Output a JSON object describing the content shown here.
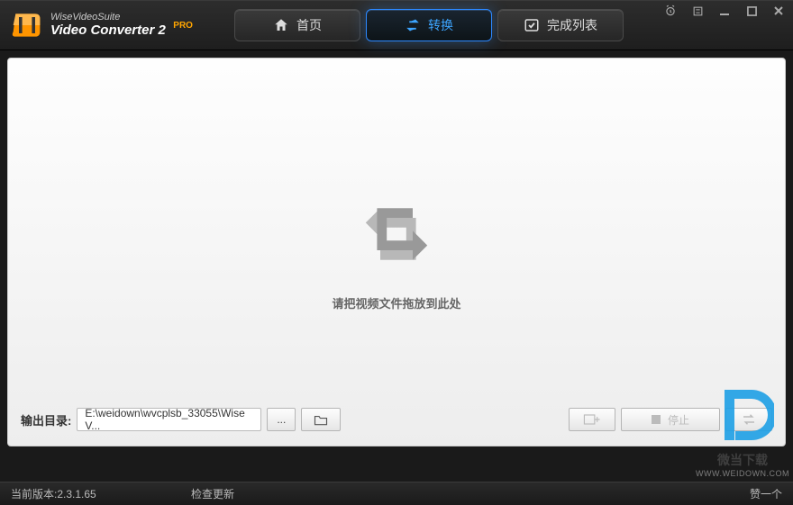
{
  "app": {
    "suite": "WiseVideoSuite",
    "name": "Video Converter 2",
    "edition": "PRO"
  },
  "tabs": {
    "home": "首页",
    "convert": "转换",
    "completed": "完成列表"
  },
  "main": {
    "drop_text": "请把视频文件拖放到此处"
  },
  "footer": {
    "output_label": "输出目录:",
    "output_path": "E:\\weidown\\wvcplsb_33055\\Wise V...",
    "more": "...",
    "pause": "停止"
  },
  "status": {
    "version": "当前版本:2.3.1.65",
    "check_update": "检查更新",
    "like": "赞一个"
  },
  "watermark": {
    "text": "微当下载",
    "url": "WWW.WEIDOWN.COM"
  }
}
